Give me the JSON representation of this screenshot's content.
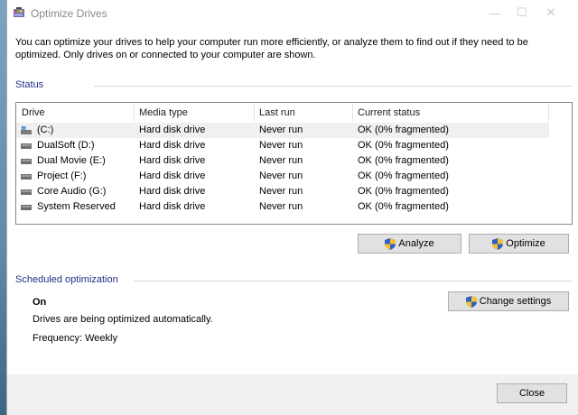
{
  "window": {
    "title": "Optimize Drives",
    "minimize_glyph": "—",
    "maximize_glyph": "☐",
    "close_glyph": "✕"
  },
  "intro": "You can optimize your drives to help your computer run more efficiently, or analyze them to find out if they need to be optimized. Only drives on or connected to your computer are shown.",
  "status": {
    "label": "Status",
    "columns": [
      "Drive",
      "Media type",
      "Last run",
      "Current status"
    ],
    "rows": [
      {
        "drive": "(C:)",
        "media": "Hard disk drive",
        "last_run": "Never run",
        "status": "OK (0% fragmented)",
        "icon": "system-drive-icon"
      },
      {
        "drive": "DualSoft (D:)",
        "media": "Hard disk drive",
        "last_run": "Never run",
        "status": "OK (0% fragmented)",
        "icon": "hard-drive-icon"
      },
      {
        "drive": "Dual Movie (E:)",
        "media": "Hard disk drive",
        "last_run": "Never run",
        "status": "OK (0% fragmented)",
        "icon": "hard-drive-icon"
      },
      {
        "drive": "Project (F:)",
        "media": "Hard disk drive",
        "last_run": "Never run",
        "status": "OK (0% fragmented)",
        "icon": "hard-drive-icon"
      },
      {
        "drive": "Core Audio (G:)",
        "media": "Hard disk drive",
        "last_run": "Never run",
        "status": "OK (0% fragmented)",
        "icon": "hard-drive-icon"
      },
      {
        "drive": "System Reserved",
        "media": "Hard disk drive",
        "last_run": "Never run",
        "status": "OK (0% fragmented)",
        "icon": "hard-drive-icon"
      }
    ],
    "analyze_label": "Analyze",
    "optimize_label": "Optimize"
  },
  "scheduled": {
    "label": "Scheduled optimization",
    "state": "On",
    "description": "Drives are being optimized automatically.",
    "frequency": "Frequency: Weekly",
    "change_settings_label": "Change settings"
  },
  "footer": {
    "close_label": "Close"
  },
  "colors": {
    "section_label": "#1e3287",
    "button_face": "#e1e1e1",
    "selected_row": "#f0f0f0"
  }
}
